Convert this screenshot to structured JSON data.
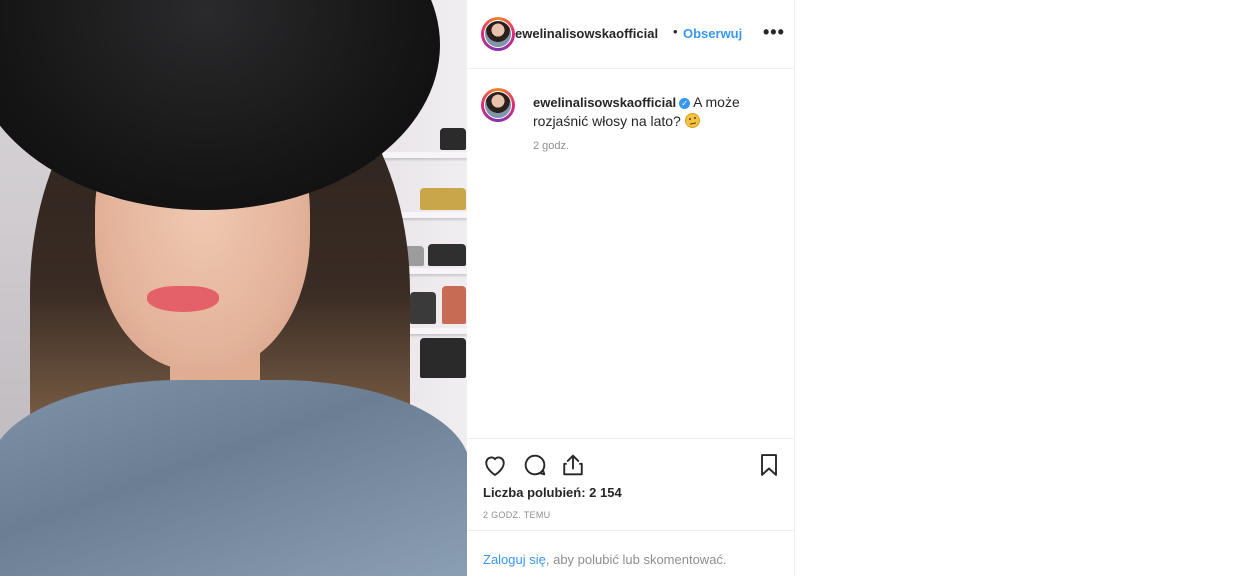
{
  "post": {
    "username": "ewelinalisowskaofficial",
    "follow_label": "Obserwuj",
    "separator": "•",
    "more_label": "•••",
    "caption_text": "A może rozjaśnić włosy na lato?",
    "caption_time": "2 godz.",
    "likes_text": "Liczba polubień: 2 154",
    "post_time": "2 GODZ. TEMU",
    "login_link": "Zaloguj się",
    "login_rest": ", aby polubić lub skomentować."
  },
  "icons": {
    "verified": "verified-badge-icon",
    "emoji": "thinking-face-emoji",
    "like": "heart-icon",
    "comment": "comment-bubble-icon",
    "share": "share-icon",
    "save": "bookmark-icon",
    "more": "more-options-icon"
  },
  "colors": {
    "link_blue": "#3897f0",
    "text": "#262626",
    "muted": "#8e8e8e",
    "divider": "#efefef"
  }
}
